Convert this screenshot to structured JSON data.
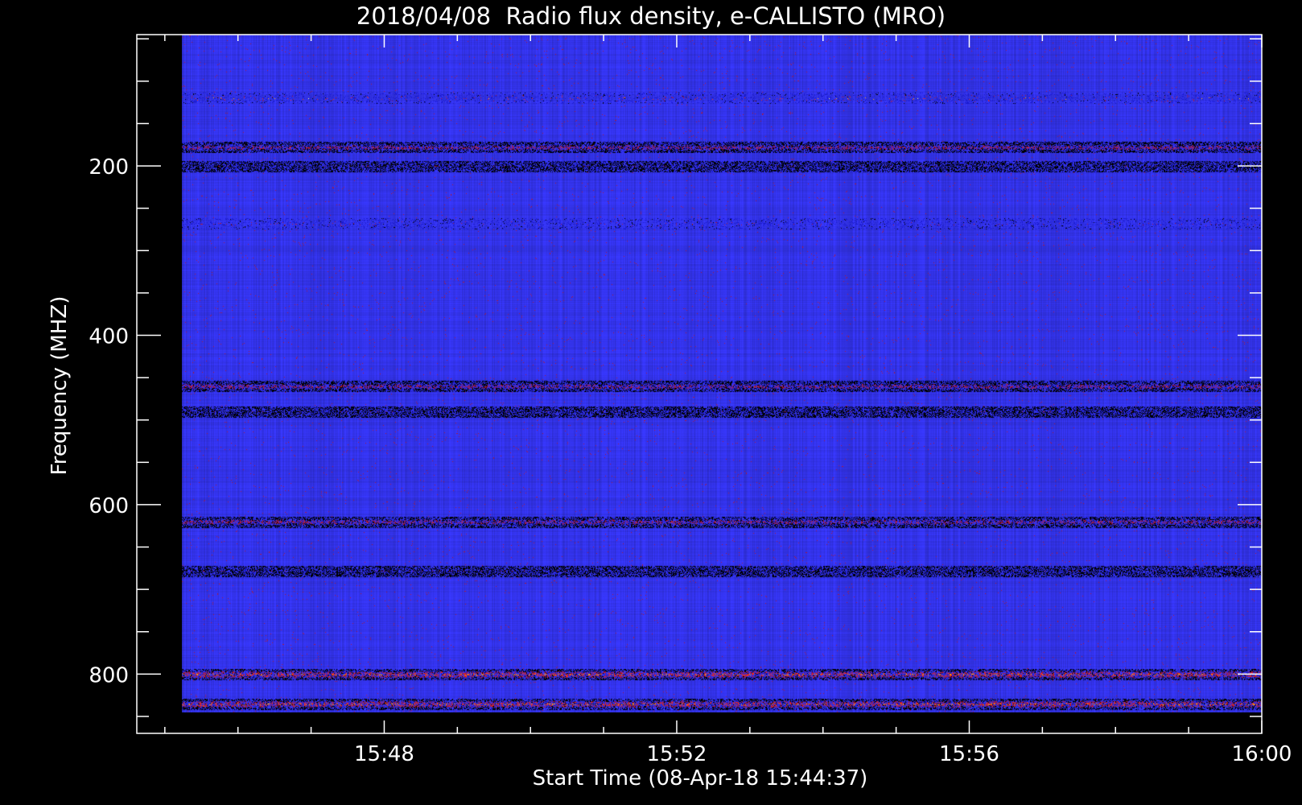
{
  "chart_data": {
    "type": "heatmap",
    "title": "2018/04/08  Radio flux density, e-CALLISTO (MRO)",
    "xlabel": "Start Time (08-Apr-18 15:44:37)",
    "ylabel": "Frequency (MHZ)",
    "x_range": [
      "15:44:37",
      "16:00:00"
    ],
    "y_range_mhz": [
      45,
      870
    ],
    "y_inverted": true,
    "x_ticks": [
      {
        "label": "15:48",
        "time": "15:48:00"
      },
      {
        "label": "15:52",
        "time": "15:52:00"
      },
      {
        "label": "15:56",
        "time": "15:56:00"
      },
      {
        "label": "16:00",
        "time": "16:00:00"
      }
    ],
    "y_ticks": [
      {
        "label": "200",
        "value": 200
      },
      {
        "label": "400",
        "value": 400
      },
      {
        "label": "600",
        "value": 600
      },
      {
        "label": "800",
        "value": 800
      }
    ],
    "data_time_range": [
      "15:45:14",
      "16:00:00"
    ],
    "data_freq_range_mhz": [
      45,
      845
    ],
    "colormap": [
      "#000000",
      "#1a1ad0",
      "#3a2cf0",
      "#3535f0",
      "#aa1a40",
      "#ff3010",
      "#ffb000",
      "#ffff90"
    ],
    "background_level_color": "#3434ee",
    "features": [
      {
        "name": "interference",
        "freq_mhz": 120,
        "intensity": "high",
        "sparse": true
      },
      {
        "name": "interference",
        "freq_mhz": 178,
        "intensity": "medium",
        "sparse": false
      },
      {
        "name": "interference",
        "freq_mhz": 200,
        "intensity": "low",
        "sparse": false
      },
      {
        "name": "interference",
        "freq_mhz": 268,
        "intensity": "medium",
        "sparse": true
      },
      {
        "name": "interference",
        "freq_mhz": 460,
        "intensity": "medium",
        "sparse": false
      },
      {
        "name": "interference",
        "freq_mhz": 490,
        "intensity": "low",
        "sparse": false
      },
      {
        "name": "interference",
        "freq_mhz": 620,
        "intensity": "medium",
        "sparse": false
      },
      {
        "name": "interference",
        "freq_mhz": 678,
        "intensity": "low",
        "sparse": false
      },
      {
        "name": "interference",
        "freq_mhz": 800,
        "intensity": "high",
        "sparse": false
      },
      {
        "name": "interference",
        "freq_mhz": 835,
        "intensity": "high",
        "sparse": false
      }
    ]
  }
}
